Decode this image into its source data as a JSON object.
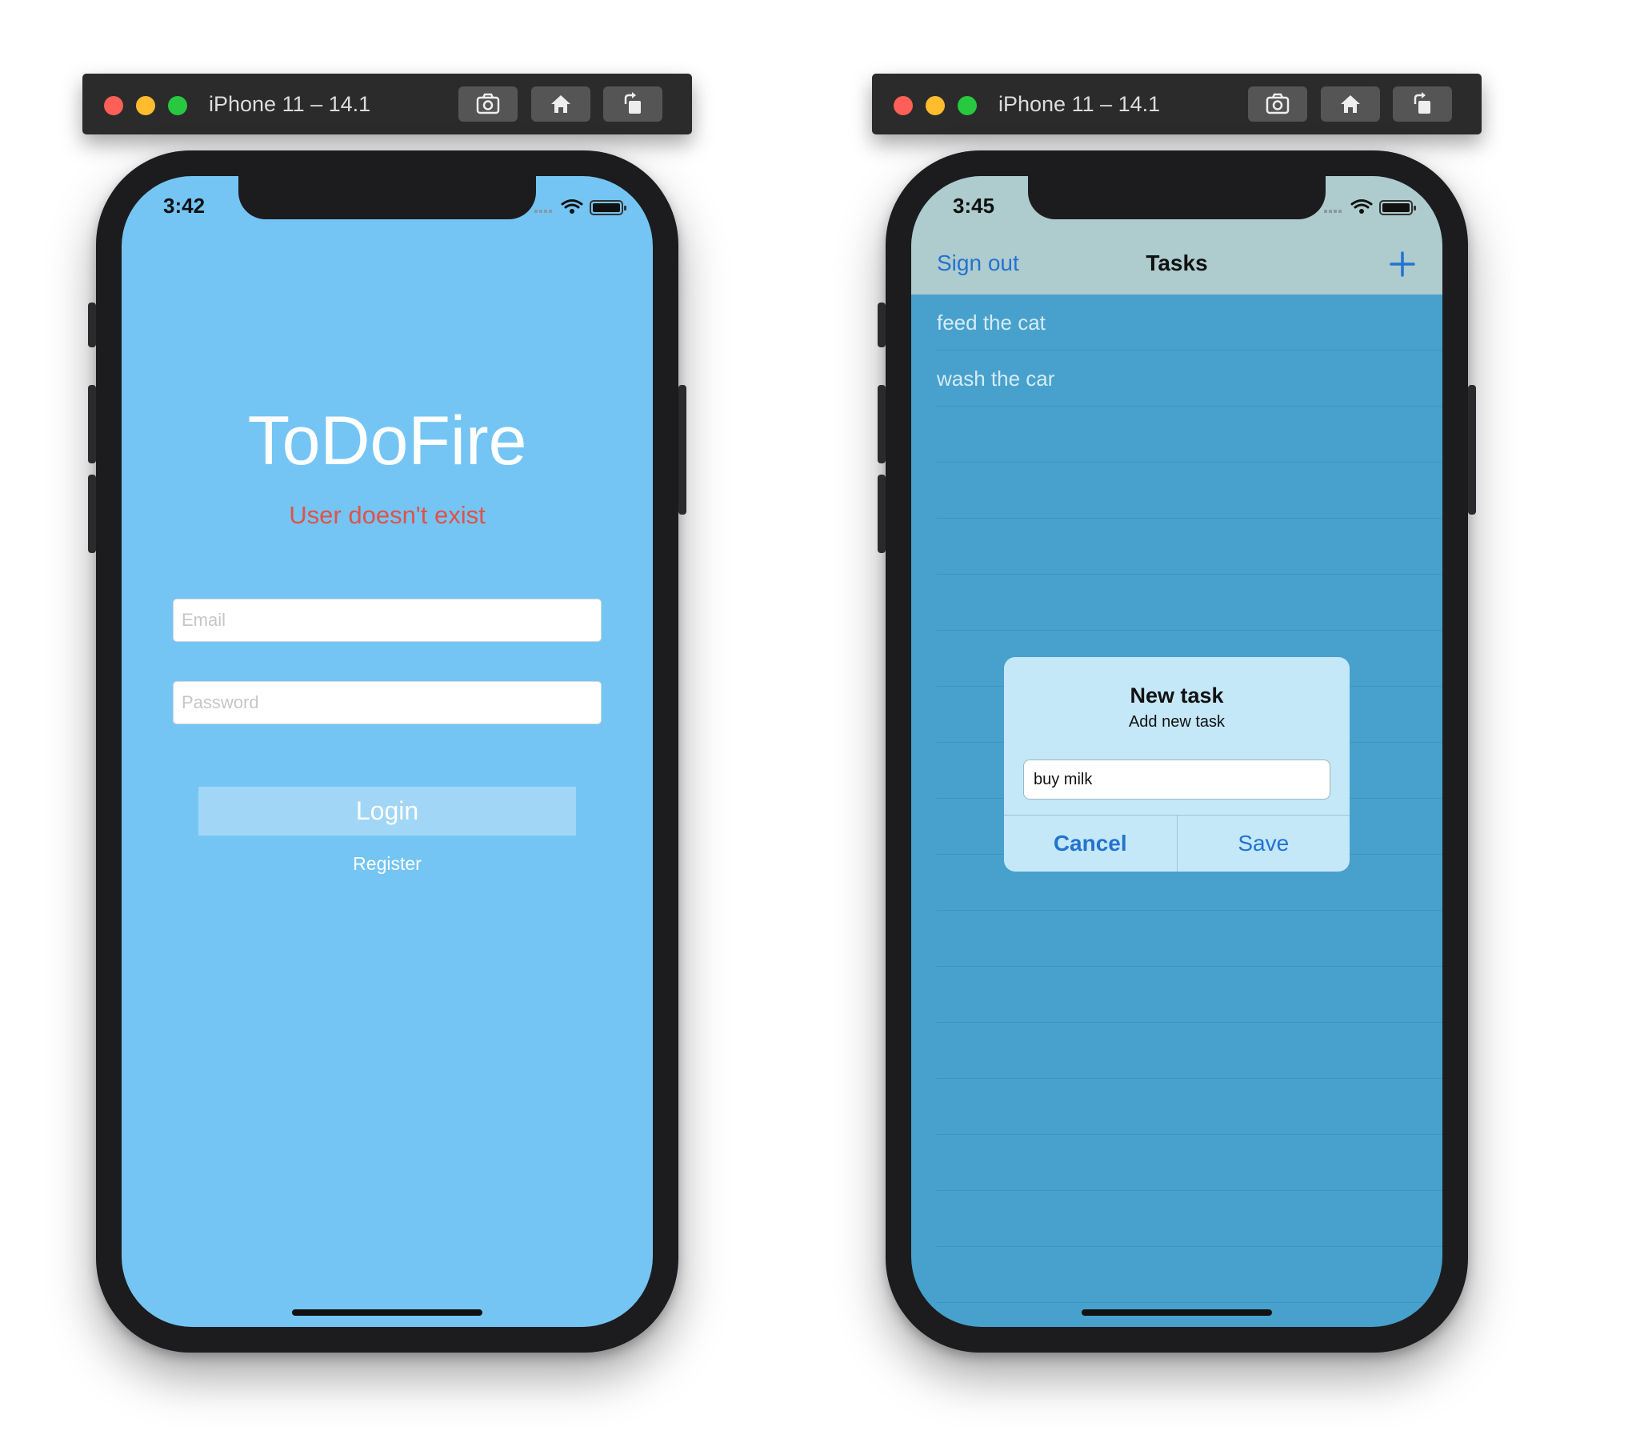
{
  "colors": {
    "login_background": "#74c5f3",
    "error_text": "#e0524b",
    "tasks_background": "#47a1cc",
    "nav_bar": "#aecbcd",
    "link_blue": "#2373d0",
    "dialog_background": "#c4e8f8"
  },
  "simulators": {
    "login": {
      "window_title": "iPhone 11 – 14.1",
      "status_time": "3:42",
      "app_title": "ToDoFire",
      "error_message": "User doesn't exist",
      "email_placeholder": "Email",
      "password_placeholder": "Password",
      "login_label": "Login",
      "register_label": "Register"
    },
    "tasks": {
      "window_title": "iPhone 11 – 14.1",
      "status_time": "3:45",
      "nav": {
        "left_label": "Sign out",
        "title": "Tasks",
        "add_icon": "plus-icon"
      },
      "tasks": [
        "feed the cat",
        "wash the car"
      ],
      "dialog": {
        "title": "New task",
        "message": "Add new task",
        "input_value": "buy milk",
        "cancel_label": "Cancel",
        "save_label": "Save"
      }
    }
  },
  "toolbar_icons": [
    "screenshot-icon",
    "home-icon",
    "rotate-icon"
  ]
}
